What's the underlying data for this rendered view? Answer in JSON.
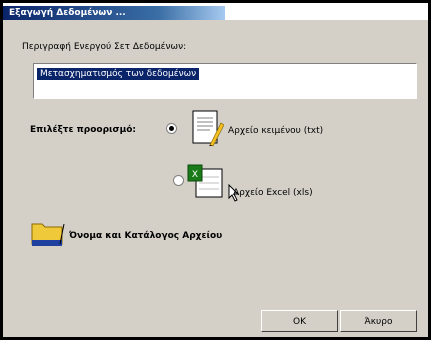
{
  "window": {
    "title": "Εξαγωγή Δεδομένων ..."
  },
  "description": {
    "label": "Περιγραφή Ενεργού Σετ Δεδομένων:",
    "value": "Μετασχηματισμός των δεδομένων"
  },
  "format": {
    "label": "Επιλέξτε προορισμό:",
    "options": [
      {
        "label": "Αρχείο κειμένου (txt)",
        "icon": "text-file-icon",
        "selected": true
      },
      {
        "label": "Αρχείο Excel (xls)",
        "icon": "excel-file-icon",
        "selected": false
      }
    ]
  },
  "folder": {
    "label": "Όνομα και Κατάλογος Αρχείου",
    "icon": "folder-icon"
  },
  "buttons": {
    "ok": "OK",
    "cancel": "Άκυρο"
  },
  "colors": {
    "titlebar": "#0a246a",
    "dialog_bg": "#d4d0c8",
    "selection": "#0a246a"
  }
}
